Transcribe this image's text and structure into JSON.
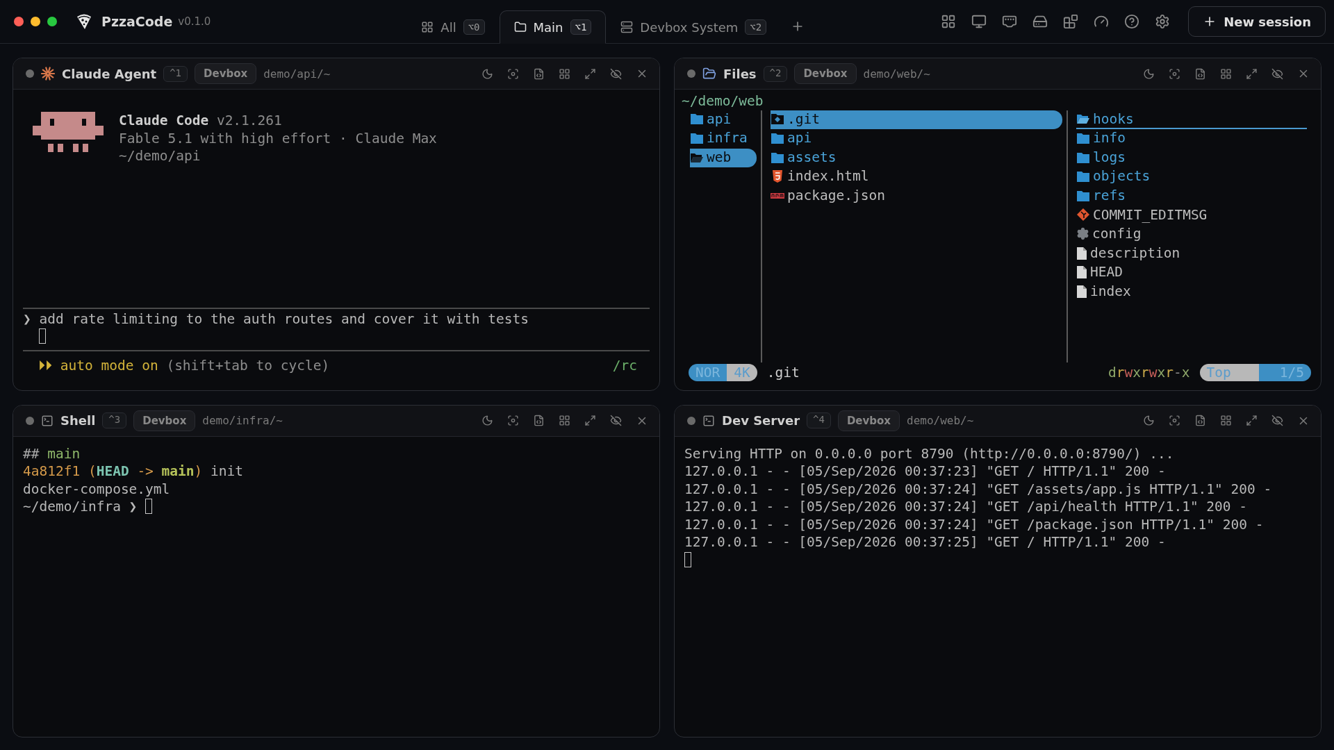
{
  "app": {
    "name": "PzzaCode",
    "version": "v0.1.0"
  },
  "tabs": [
    {
      "label": "All",
      "shortcut": "⌥0",
      "kind": "all",
      "selected": false
    },
    {
      "label": "Main",
      "shortcut": "⌥1",
      "kind": "folder",
      "selected": true
    },
    {
      "label": "Devbox System",
      "shortcut": "⌥2",
      "kind": "server",
      "selected": false
    }
  ],
  "new_session": "New session",
  "panels": [
    {
      "kind": "claude",
      "title": "Claude Agent",
      "shortcut": "^1",
      "host": "Devbox",
      "path": "demo/api/~",
      "product": "Claude Code",
      "product_version": "v2.1.261",
      "model_line": "Fable 5.1 with high effort · Claude Max",
      "cwd": "~/demo/api",
      "prompt_symbol": "❯",
      "prompt": "add rate limiting to the auth routes and cover it with tests",
      "mode_symbol": "⏵⏵",
      "mode": "auto mode on",
      "mode_hint": "(shift+tab to cycle)",
      "shortcut_hint": "/rc"
    },
    {
      "kind": "files",
      "title": "Files",
      "shortcut": "^2",
      "host": "Devbox",
      "path": "demo/web/~",
      "cwd": "~/demo/web",
      "parent_column": [
        {
          "name": "api",
          "kind": "folder",
          "selected": false
        },
        {
          "name": "infra",
          "kind": "folder",
          "selected": false
        },
        {
          "name": "web",
          "kind": "folder",
          "selected": true
        }
      ],
      "current_column": [
        {
          "name": ".git",
          "kind": "git-folder",
          "selected": true
        },
        {
          "name": "api",
          "kind": "folder",
          "selected": false
        },
        {
          "name": "assets",
          "kind": "folder",
          "selected": false
        },
        {
          "name": "index.html",
          "kind": "html",
          "selected": false
        },
        {
          "name": "package.json",
          "kind": "npm",
          "selected": false
        }
      ],
      "preview_column": [
        {
          "name": "hooks",
          "kind": "folder",
          "selected": true
        },
        {
          "name": "info",
          "kind": "folder",
          "selected": false
        },
        {
          "name": "logs",
          "kind": "folder",
          "selected": false
        },
        {
          "name": "objects",
          "kind": "folder",
          "selected": false
        },
        {
          "name": "refs",
          "kind": "folder",
          "selected": false
        },
        {
          "name": "COMMIT_EDITMSG",
          "kind": "git",
          "selected": false
        },
        {
          "name": "config",
          "kind": "config",
          "selected": false
        },
        {
          "name": "description",
          "kind": "file",
          "selected": false
        },
        {
          "name": "HEAD",
          "kind": "file",
          "selected": false
        },
        {
          "name": "index",
          "kind": "file",
          "selected": false
        }
      ],
      "status": {
        "mode": "NOR",
        "size": "4K",
        "current": ".git",
        "position": "Top",
        "count": "1/5",
        "permissions": [
          {
            "text": "d",
            "color": "#8fa86a"
          },
          {
            "text": "r",
            "color": "#c9a94a"
          },
          {
            "text": "w",
            "color": "#c9605a"
          },
          {
            "text": "x",
            "color": "#8fa86a"
          },
          {
            "text": "r",
            "color": "#c9a94a"
          },
          {
            "text": "w",
            "color": "#c9605a"
          },
          {
            "text": "x",
            "color": "#8fa86a"
          },
          {
            "text": "r",
            "color": "#c9a94a"
          },
          {
            "text": "-",
            "color": "#8a8a8a"
          },
          {
            "text": "x",
            "color": "#8fa86a"
          }
        ]
      }
    },
    {
      "kind": "terminal",
      "title": "Shell",
      "shortcut": "^3",
      "host": "Devbox",
      "path": "demo/infra/~",
      "cursor_new_line": false,
      "lines": [
        {
          "segments": [
            {
              "text": "## ",
              "color": "#a8a8a8",
              "bold": false
            },
            {
              "text": "main",
              "color": "#8fb86a",
              "bold": false
            }
          ]
        },
        {
          "segments": [
            {
              "text": "4a812f1 (",
              "color": "#d59a4a",
              "bold": false
            },
            {
              "text": "HEAD",
              "color": "#7cc4b0",
              "bold": true
            },
            {
              "text": " -> ",
              "color": "#d59a4a",
              "bold": false
            },
            {
              "text": "main",
              "color": "#b6c35a",
              "bold": true
            },
            {
              "text": ")",
              "color": "#d59a4a",
              "bold": false
            },
            {
              "text": " init",
              "color": "#b8b8b8",
              "bold": false
            }
          ]
        },
        {
          "segments": [
            {
              "text": "docker-compose.yml",
              "color": "#b8b8b8",
              "bold": false
            }
          ]
        },
        {
          "segments": [
            {
              "text": "~/demo/infra ❯ ",
              "color": "#b8b8b8",
              "bold": false
            }
          ]
        }
      ]
    },
    {
      "kind": "terminal",
      "title": "Dev Server",
      "shortcut": "^4",
      "host": "Devbox",
      "path": "demo/web/~",
      "cursor_new_line": true,
      "lines": [
        {
          "segments": [
            {
              "text": "Serving HTTP on 0.0.0.0 port 8790 (http://0.0.0.0:8790/) ...",
              "color": "#b8b8b8",
              "bold": false
            }
          ]
        },
        {
          "segments": [
            {
              "text": "127.0.0.1 - - [05/Sep/2026 00:37:23] \"GET / HTTP/1.1\" 200 -",
              "color": "#b8b8b8",
              "bold": false
            }
          ]
        },
        {
          "segments": [
            {
              "text": "127.0.0.1 - - [05/Sep/2026 00:37:24] \"GET /assets/app.js HTTP/1.1\" 200 -",
              "color": "#b8b8b8",
              "bold": false
            }
          ]
        },
        {
          "segments": [
            {
              "text": "127.0.0.1 - - [05/Sep/2026 00:37:24] \"GET /api/health HTTP/1.1\" 200 -",
              "color": "#b8b8b8",
              "bold": false
            }
          ]
        },
        {
          "segments": [
            {
              "text": "127.0.0.1 - - [05/Sep/2026 00:37:24] \"GET /package.json HTTP/1.1\" 200 -",
              "color": "#b8b8b8",
              "bold": false
            }
          ]
        },
        {
          "segments": [
            {
              "text": "127.0.0.1 - - [05/Sep/2026 00:37:25] \"GET / HTTP/1.1\" 200 -",
              "color": "#b8b8b8",
              "bold": false
            }
          ]
        }
      ]
    }
  ]
}
